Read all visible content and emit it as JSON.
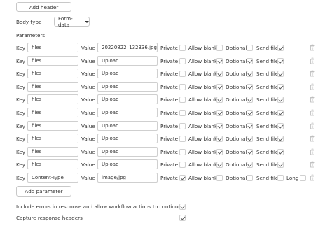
{
  "buttons": {
    "add_header": "Add header",
    "add_parameter": "Add parameter"
  },
  "body_type": {
    "label": "Body type",
    "value": "Form-data"
  },
  "parameters_label": "Parameters",
  "row_labels": {
    "key": "Key",
    "value": "Value",
    "private": "Private",
    "allow_blank": "Allow blank",
    "optional": "Optional",
    "send_file": "Send file",
    "long": "Long"
  },
  "params": [
    {
      "key": "files",
      "value": "20220822_132336.jpg",
      "private": false,
      "allow_blank": false,
      "optional": false,
      "send_file": true
    },
    {
      "key": "files",
      "value": "Upload",
      "private": false,
      "allow_blank": true,
      "optional": true,
      "send_file": true
    },
    {
      "key": "files",
      "value": "Upload",
      "private": false,
      "allow_blank": true,
      "optional": true,
      "send_file": true
    },
    {
      "key": "files",
      "value": "Upload",
      "private": false,
      "allow_blank": true,
      "optional": true,
      "send_file": true
    },
    {
      "key": "files",
      "value": "Upload",
      "private": false,
      "allow_blank": true,
      "optional": true,
      "send_file": true
    },
    {
      "key": "files",
      "value": "Upload",
      "private": false,
      "allow_blank": true,
      "optional": true,
      "send_file": true
    },
    {
      "key": "files",
      "value": "Upload",
      "private": false,
      "allow_blank": true,
      "optional": true,
      "send_file": true
    },
    {
      "key": "files",
      "value": "Upload",
      "private": false,
      "allow_blank": true,
      "optional": true,
      "send_file": true
    },
    {
      "key": "files",
      "value": "Upload",
      "private": false,
      "allow_blank": true,
      "optional": true,
      "send_file": true
    },
    {
      "key": "files",
      "value": "Upload",
      "private": false,
      "allow_blank": true,
      "optional": true,
      "send_file": true
    },
    {
      "key": "Content-Type",
      "value": "image/jpg",
      "private": true,
      "allow_blank": false,
      "optional": false,
      "send_file": false,
      "long": false
    }
  ],
  "options": {
    "include_errors": {
      "label": "Include errors in response and allow workflow actions to continue",
      "checked": true
    },
    "capture_headers": {
      "label": "Capture response headers",
      "checked": true
    }
  }
}
